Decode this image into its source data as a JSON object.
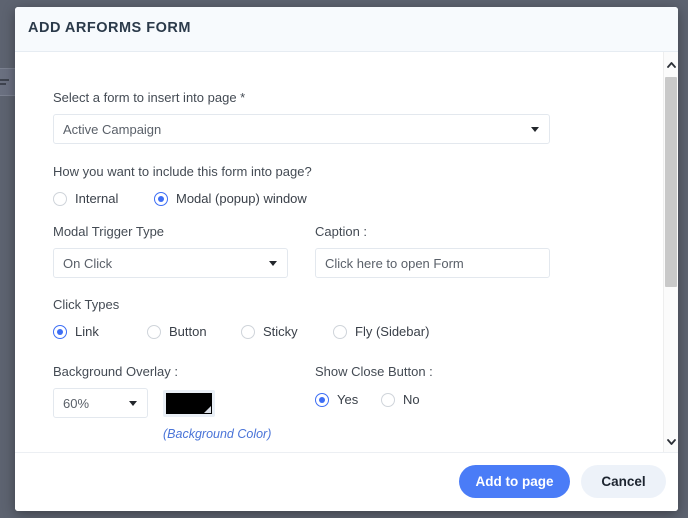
{
  "modal": {
    "title": "ADD ARFORMS FORM",
    "fields": {
      "form_select": {
        "label": "Select a form to insert into page",
        "required_marker": "*",
        "value": "Active Campaign",
        "caret_icon": "chevron-down-icon"
      },
      "include_method": {
        "label": "How you want to include this form into page?",
        "options": [
          {
            "label": "Internal",
            "checked": false
          },
          {
            "label": "Modal (popup) window",
            "checked": true
          }
        ]
      },
      "modal_trigger": {
        "label": "Modal Trigger Type",
        "value": "On Click",
        "caret_icon": "chevron-down-icon"
      },
      "caption": {
        "label": "Caption :",
        "value": "Click here to open Form",
        "placeholder": "Click here to open Form"
      },
      "click_types": {
        "label": "Click Types",
        "options": [
          {
            "label": "Link",
            "checked": true
          },
          {
            "label": "Button",
            "checked": false
          },
          {
            "label": "Sticky",
            "checked": false
          },
          {
            "label": "Fly (Sidebar)",
            "checked": false
          }
        ]
      },
      "background_overlay": {
        "label": "Background Overlay :",
        "value": "60%",
        "caret_icon": "chevron-down-icon",
        "swatch_color": "#000000",
        "swatch_note": "(Background Color)"
      },
      "show_close_button": {
        "label": "Show Close Button :",
        "options": [
          {
            "label": "Yes",
            "checked": true
          },
          {
            "label": "No",
            "checked": false
          }
        ]
      }
    },
    "footer": {
      "primary_label": "Add to page",
      "secondary_label": "Cancel"
    },
    "scrollbar": {
      "up_icon": "chevron-up-icon",
      "down_icon": "chevron-down-icon"
    }
  },
  "colors": {
    "accent": "#4a7cf7",
    "radio_checked": "#3d6ef5",
    "backdrop": "#5d6370",
    "note_text": "#4a74d8",
    "swatch": "#000000"
  }
}
